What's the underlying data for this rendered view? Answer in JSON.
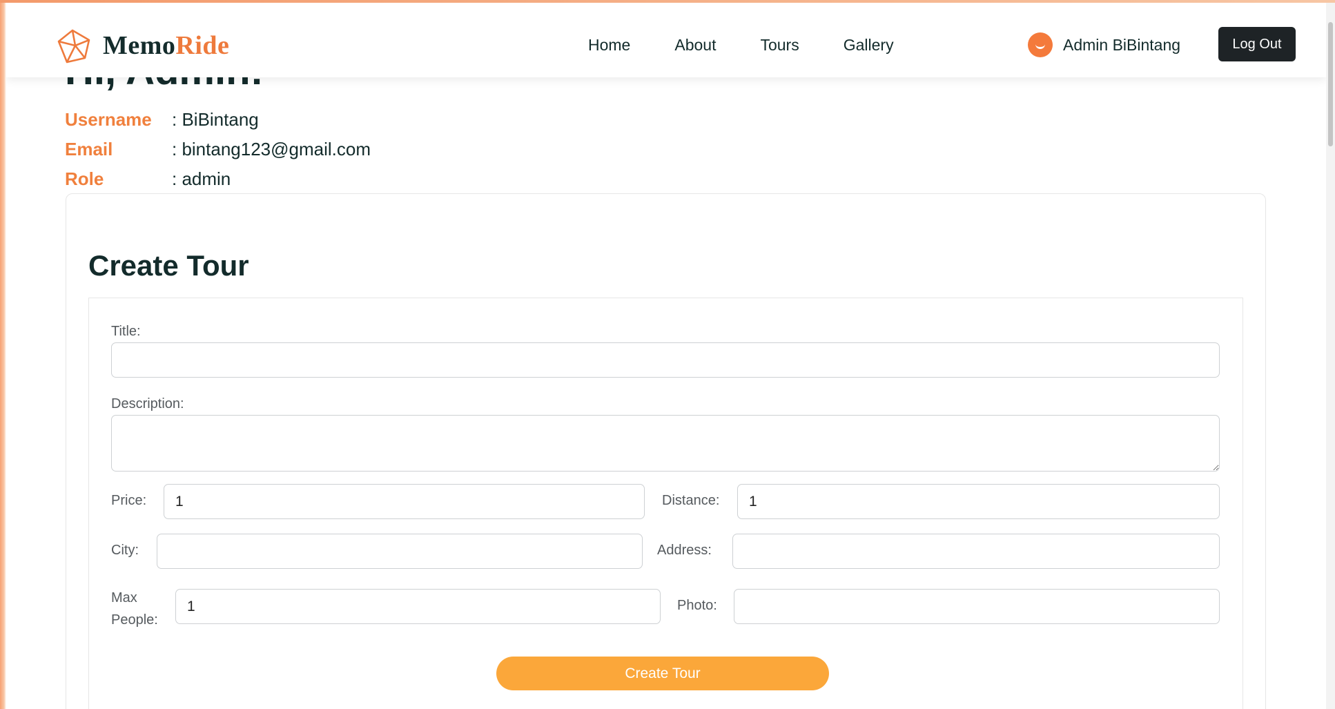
{
  "navbar": {
    "brand_part1": "Memo",
    "brand_part2": "Ride",
    "links": [
      "Home",
      "About",
      "Tours",
      "Gallery"
    ],
    "user_name": "Admin BiBintang",
    "logout_label": "Log Out"
  },
  "greeting": "Hi, Admin!",
  "profile": {
    "username_label": "Username",
    "username_value": ": BiBintang",
    "email_label": "Email",
    "email_value": ": bintang123@gmail.com",
    "role_label": "Role",
    "role_value": ": admin"
  },
  "form": {
    "heading": "Create Tour",
    "title_label": "Title:",
    "title_value": "",
    "description_label": "Description:",
    "description_value": "",
    "price_label": "Price:",
    "price_value": "1",
    "distance_label": "Distance:",
    "distance_value": "1",
    "city_label": "City:",
    "city_value": "",
    "address_label": "Address:",
    "address_value": "",
    "max_people_label_line1": "Max",
    "max_people_label_line2": "People:",
    "max_people_value": "1",
    "photo_label": "Photo:",
    "photo_value": "",
    "submit_label": "Create Tour"
  },
  "colors": {
    "accent_orange": "#ee7a3c",
    "button_orange": "#fba73a",
    "dark_button": "#1e2326",
    "text_dark": "#132b2b"
  },
  "icons": {
    "brand": "cube-logo-icon",
    "avatar": "smiley-avatar-icon"
  }
}
